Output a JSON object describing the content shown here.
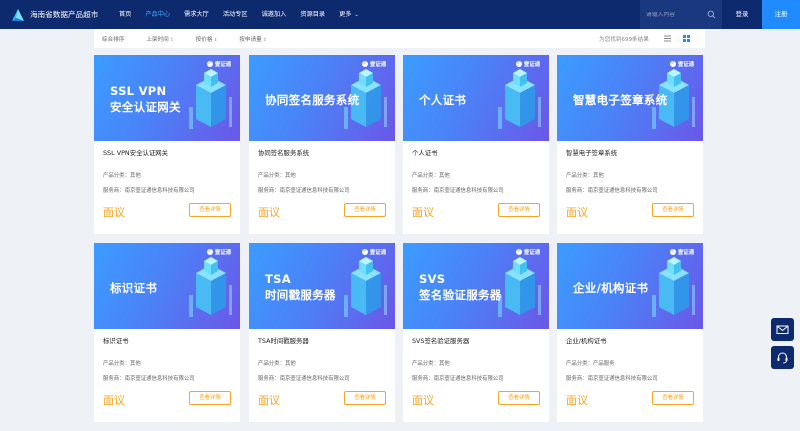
{
  "header": {
    "site_title": "海南省数据产品超市",
    "nav": [
      {
        "label": "首页",
        "active": false
      },
      {
        "label": "产品中心",
        "active": true
      },
      {
        "label": "需求大厅",
        "active": false
      },
      {
        "label": "活动专区",
        "active": false
      },
      {
        "label": "诚邀加入",
        "active": false
      },
      {
        "label": "资源目录",
        "active": false
      },
      {
        "label": "更多",
        "active": false
      }
    ],
    "search_placeholder": "请输入内容",
    "login_label": "登录",
    "register_label": "注册"
  },
  "sortbar": {
    "items": [
      "综合排序",
      "上架时间",
      "按价格",
      "按申请量"
    ],
    "result_text": "为您找到699条结果"
  },
  "products": [
    {
      "banner_lines": [
        "SSL VPN",
        "安全认证网关"
      ],
      "title": "SSL VPN安全认证网关",
      "category_label": "产品分类：",
      "category": "其他",
      "provider_label": "服务商：",
      "provider": "南京壹证通信息科技有限公司",
      "price": "面议",
      "detail_label": "查看详情"
    },
    {
      "banner_lines": [
        "协同签名服务系统"
      ],
      "title": "协同签名服务系统",
      "category_label": "产品分类：",
      "category": "其他",
      "provider_label": "服务商：",
      "provider": "南京壹证通信息科技有限公司",
      "price": "面议",
      "detail_label": "查看详情"
    },
    {
      "banner_lines": [
        "个人证书"
      ],
      "title": "个人证书",
      "category_label": "产品分类：",
      "category": "其他",
      "provider_label": "服务商：",
      "provider": "南京壹证通信息科技有限公司",
      "price": "面议",
      "detail_label": "查看详情"
    },
    {
      "banner_lines": [
        "智慧电子签章系统"
      ],
      "title": "智慧电子签章系统",
      "category_label": "产品分类：",
      "category": "其他",
      "provider_label": "服务商：",
      "provider": "南京壹证通信息科技有限公司",
      "price": "面议",
      "detail_label": "查看详情"
    },
    {
      "banner_lines": [
        "标识证书"
      ],
      "title": "标识证书",
      "category_label": "产品分类：",
      "category": "其他",
      "provider_label": "服务商：",
      "provider": "南京壹证通信息科技有限公司",
      "price": "面议",
      "detail_label": "查看详情"
    },
    {
      "banner_lines": [
        "TSA",
        "时间戳服务器"
      ],
      "title": "TSA时间戳服务器",
      "category_label": "产品分类：",
      "category": "其他",
      "provider_label": "服务商：",
      "provider": "南京壹证通信息科技有限公司",
      "price": "面议",
      "detail_label": "查看详情"
    },
    {
      "banner_lines": [
        "SVS",
        "签名验证服务器"
      ],
      "title": "SVS签名验证服务器",
      "category_label": "产品分类：",
      "category": "其他",
      "provider_label": "服务商：",
      "provider": "南京壹证通信息科技有限公司",
      "price": "面议",
      "detail_label": "查看详情"
    },
    {
      "banner_lines": [
        "企业/机构证书"
      ],
      "title": "企业/机构证书",
      "category_label": "产品分类：",
      "category": "产品服务",
      "provider_label": "服务商：",
      "provider": "南京壹证通信息科技有限公司",
      "price": "面议",
      "detail_label": "查看详情"
    }
  ],
  "brand_badge": "壹证通",
  "icons": {
    "logo": "logo-icon",
    "search": "search-icon",
    "list_view": "list-view-icon",
    "grid_view": "grid-view-icon",
    "message": "mail-icon",
    "support": "headset-icon"
  },
  "colors": {
    "header_bg": "#0d2a6e",
    "accent": "#1f8bff",
    "price": "#f5a623"
  }
}
